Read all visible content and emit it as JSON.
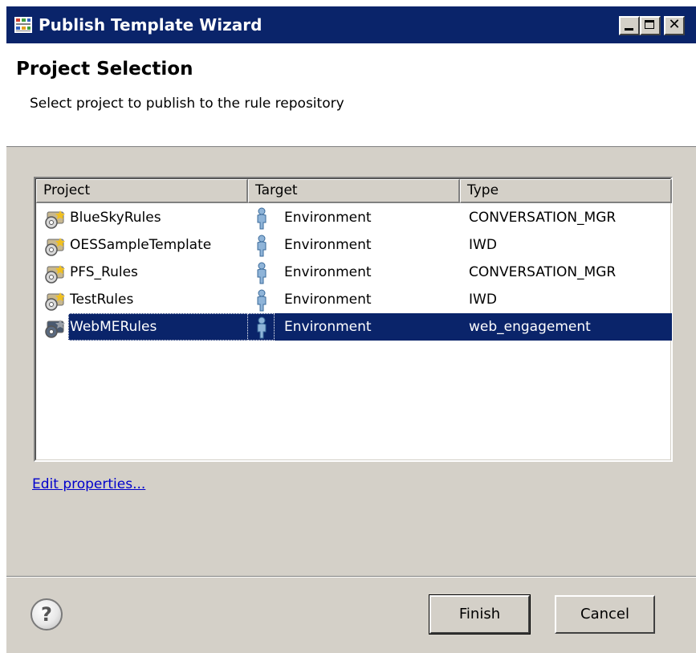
{
  "window": {
    "title": "Publish Template Wizard",
    "title_bar_color": "#0a246a",
    "controls": {
      "minimize_glyph": "_",
      "maximize_glyph": "□",
      "close_glyph": "✕"
    }
  },
  "header": {
    "title": "Project Selection",
    "description": "Select project to publish to the rule repository"
  },
  "table": {
    "columns": [
      "Project",
      "Target",
      "Type"
    ],
    "rows": [
      {
        "project": "BlueSkyRules",
        "target": "Environment",
        "type": "CONVERSATION_MGR",
        "selected": false
      },
      {
        "project": "OESSampleTemplate",
        "target": "Environment",
        "type": "IWD",
        "selected": false
      },
      {
        "project": "PFS_Rules",
        "target": "Environment",
        "type": "CONVERSATION_MGR",
        "selected": false
      },
      {
        "project": "TestRules",
        "target": "Environment",
        "type": "IWD",
        "selected": false
      },
      {
        "project": "WebMERules",
        "target": "Environment",
        "type": "web_engagement",
        "selected": true
      }
    ],
    "selection_color": "#0a246a"
  },
  "links": {
    "edit_properties": "Edit properties..."
  },
  "footer": {
    "help_glyph": "?",
    "finish_label": "Finish",
    "cancel_label": "Cancel"
  },
  "icons": {
    "title": "wizard-app-icon",
    "project": "project-gear-icon",
    "target": "person-environment-icon",
    "help": "help-icon"
  }
}
